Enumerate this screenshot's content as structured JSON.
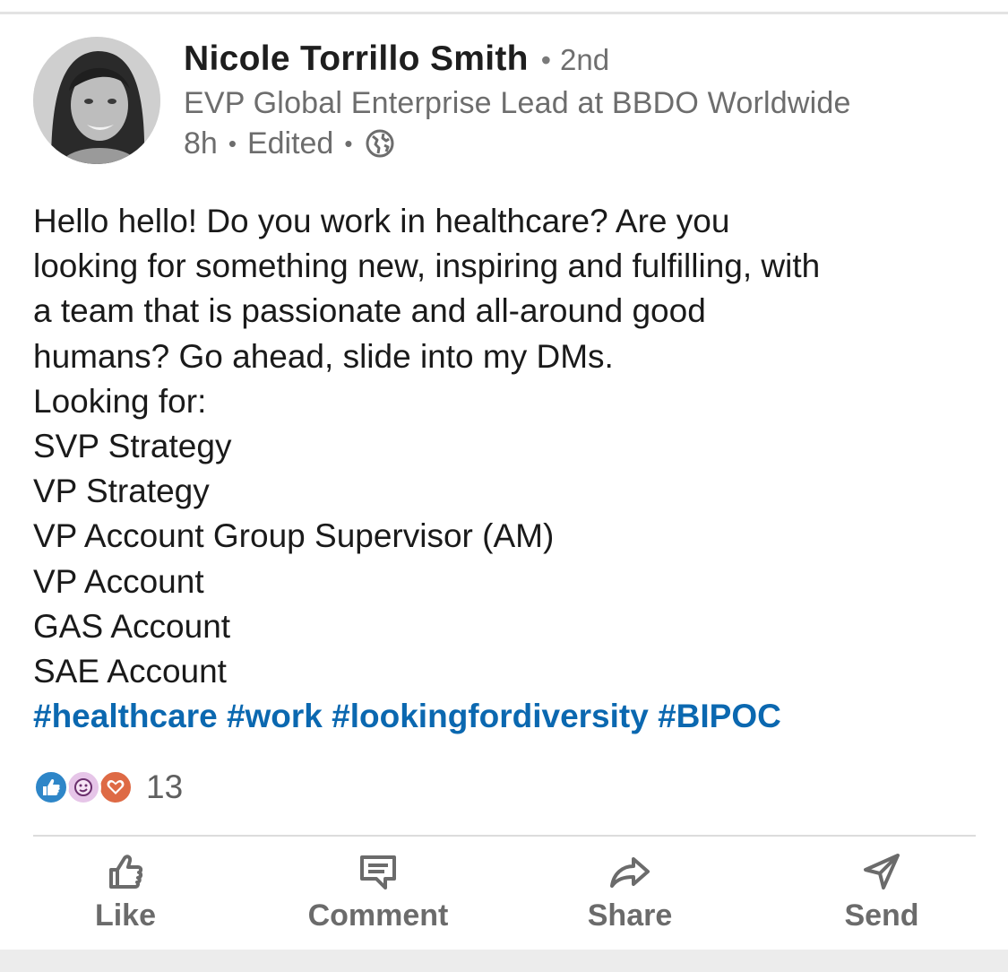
{
  "author": {
    "name": "Nicole Torrillo Smith",
    "degree": "2nd",
    "headline": "EVP Global Enterprise Lead at BBDO Worldwide",
    "time": "8h",
    "edited": "Edited",
    "visibility_icon": "globe-icon"
  },
  "post": {
    "intro_lines": [
      "Hello hello! Do you work in healthcare? Are you",
      "looking for something new, inspiring and fulfilling, with",
      "a team that is passionate and all-around good",
      "humans? Go ahead, slide into my DMs."
    ],
    "looking_for_label": "Looking for:",
    "roles": [
      "SVP Strategy",
      "VP Strategy",
      "VP Account Group Supervisor (AM)",
      "VP Account",
      "GAS Account",
      "SAE Account"
    ],
    "hashtags": [
      "#healthcare",
      "#work",
      "#lookingfordiversity",
      "#BIPOC"
    ]
  },
  "reactions": {
    "icons": [
      "like-reaction-icon",
      "curious-reaction-icon",
      "love-reaction-icon"
    ],
    "count": "13"
  },
  "actions": {
    "like": "Like",
    "comment": "Comment",
    "share": "Share",
    "send": "Send"
  },
  "colors": {
    "hashtag": "#0b68b0",
    "like_reaction": "#2e86c8",
    "curious_reaction": "#e6c5e8",
    "love_reaction": "#de6a45"
  }
}
